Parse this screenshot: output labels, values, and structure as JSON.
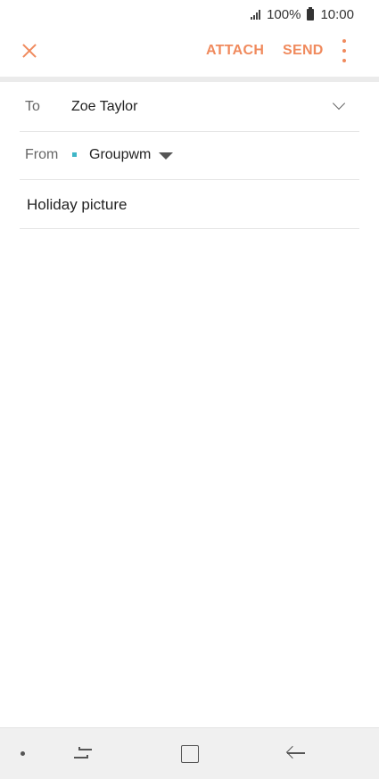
{
  "status_bar": {
    "battery_level": "100%",
    "time": "10:00"
  },
  "toolbar": {
    "close_icon": "close-icon",
    "attach_label": "ATTACH",
    "send_label": "SEND",
    "more_icon": "more-vertical-icon",
    "accent_color": "#f08a5d"
  },
  "compose": {
    "to_label": "To",
    "to_value": "Zoe Taylor",
    "from_label": "From",
    "from_value": "Groupwm",
    "from_dot_color": "#3fb6c7",
    "subject": "Holiday picture"
  },
  "nav_bar": {
    "icons": [
      "dot-icon",
      "recent-apps-icon",
      "home-icon",
      "back-icon"
    ]
  }
}
